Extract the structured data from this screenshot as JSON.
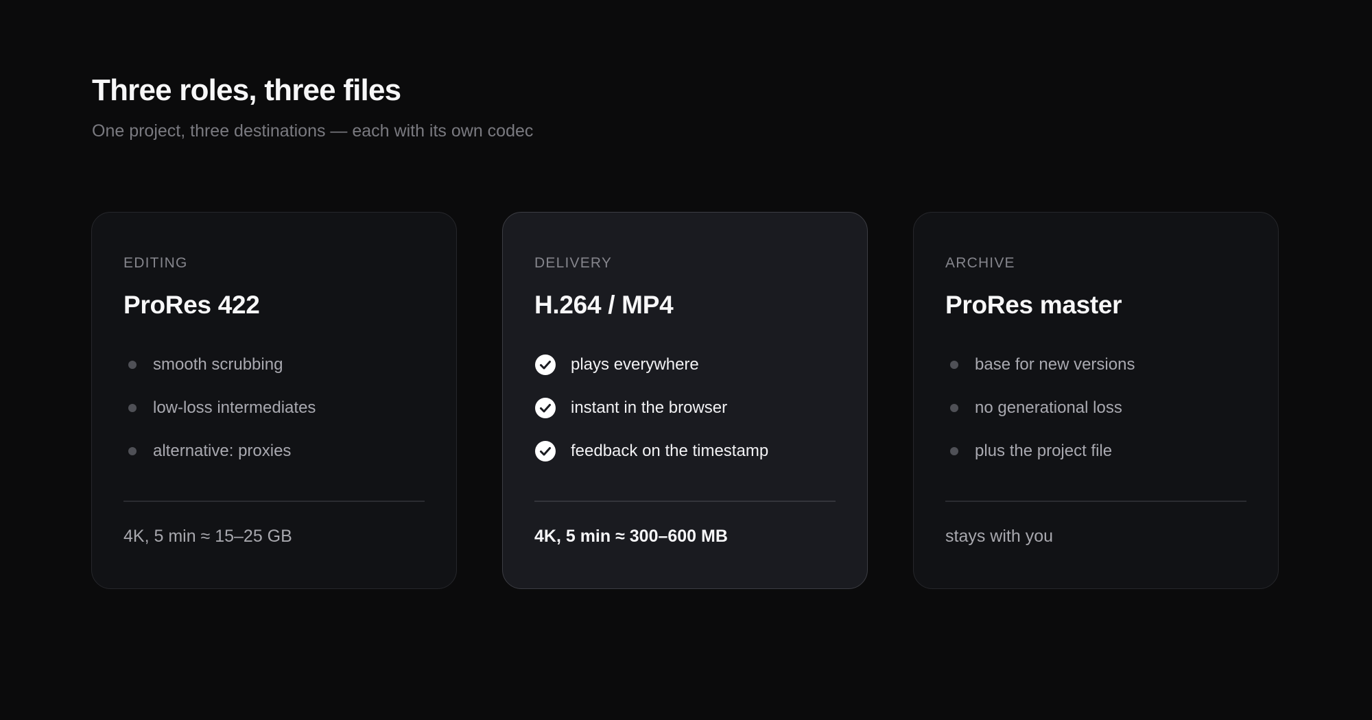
{
  "header": {
    "title": "Three roles, three files",
    "subtitle": "One project, three destinations — each with its own codec"
  },
  "cards": [
    {
      "role": "EDITING",
      "codec": "ProRes 422",
      "bullet_icon": "dot-icon",
      "features": [
        "smooth scrubbing",
        "low-loss intermediates",
        "alternative: proxies"
      ],
      "footnote": "4K, 5 min ≈ 15–25 GB"
    },
    {
      "role": "DELIVERY",
      "codec": "H.264 / MP4",
      "bullet_icon": "check-circle-icon",
      "features": [
        "plays everywhere",
        "instant in the browser",
        "feedback on the timestamp"
      ],
      "footnote": "4K, 5 min ≈ 300–600 MB"
    },
    {
      "role": "ARCHIVE",
      "codec": "ProRes master",
      "bullet_icon": "dot-icon",
      "features": [
        "base for new versions",
        "no generational loss",
        "plus the project file"
      ],
      "footnote": "stays with you"
    }
  ],
  "colors": {
    "background": "#0b0b0c",
    "card": "#111215",
    "card_featured": "#1a1b20",
    "text_primary": "#f7f7f8",
    "text_muted": "#7a7a80"
  }
}
